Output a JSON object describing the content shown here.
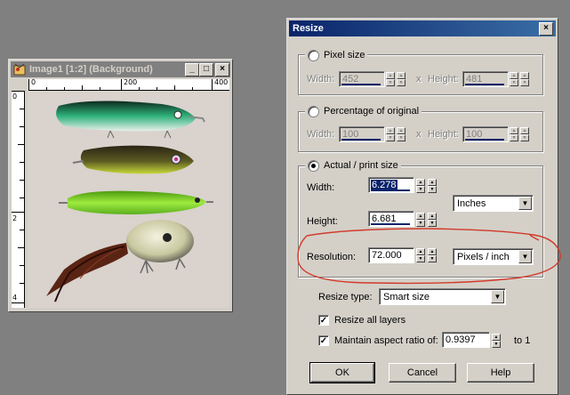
{
  "image_window": {
    "title": "Image1 [1:2] (Background)",
    "min_label": "_",
    "max_label": "□",
    "close_label": "×",
    "ruler_top": [
      "0",
      "200",
      "400"
    ],
    "ruler_left": [
      "0",
      "2",
      "4"
    ],
    "icon": "paint-shop-pro-icon"
  },
  "dialog": {
    "title": "Resize",
    "close_label": "×",
    "pixel_size": {
      "label": "Pixel size",
      "width_label": "Width:",
      "width_value": "452",
      "x_label": "x",
      "height_label": "Height:",
      "height_value": "481"
    },
    "percentage": {
      "label": "Percentage of original",
      "width_label": "Width:",
      "width_value": "100",
      "x_label": "x",
      "height_label": "Height:",
      "height_value": "100"
    },
    "actual_print": {
      "label": "Actual / print size",
      "width_label": "Width:",
      "width_value": "6.278",
      "height_label": "Height:",
      "height_value": "6.681",
      "units_select": "Inches",
      "resolution_label": "Resolution:",
      "resolution_value": "72.000",
      "resolution_units": "Pixels / inch"
    },
    "resize_type_label": "Resize type:",
    "resize_type_value": "Smart size",
    "resize_all_layers_label": "Resize all layers",
    "maintain_aspect_label": "Maintain aspect ratio of:",
    "aspect_value": "0.9397",
    "to_one_label": "to 1",
    "ok_label": "OK",
    "cancel_label": "Cancel",
    "help_label": "Help"
  },
  "colors": {
    "annotation_circle": "#d23a2a",
    "title_active": "#0a246a",
    "title_inactive": "#808080",
    "face": "#d4d0c8",
    "desktop": "#808080"
  }
}
